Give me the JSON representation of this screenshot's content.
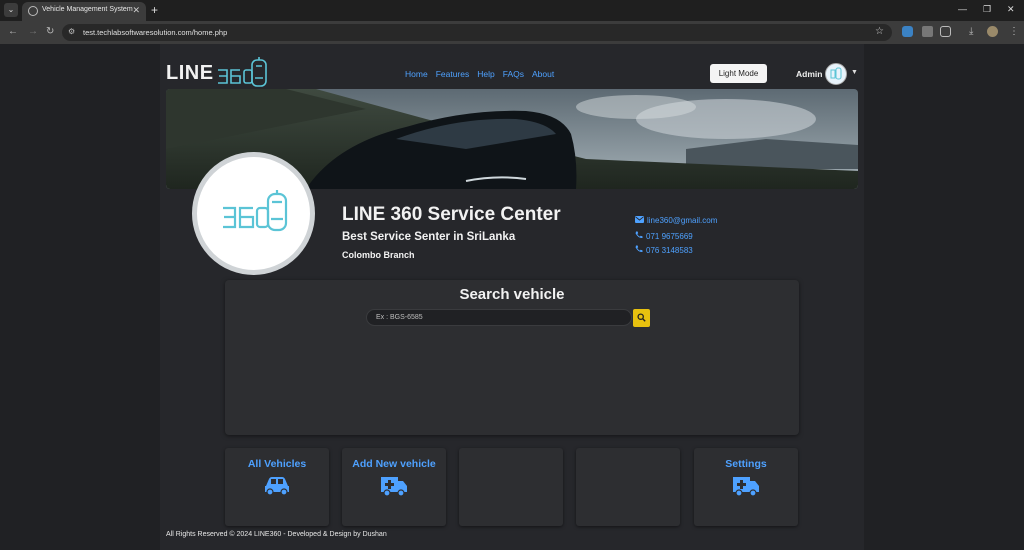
{
  "browser": {
    "tab_title": "Vehicle Management System",
    "url": "test.techlabsoftwaresolution.com/home.php"
  },
  "header": {
    "logo_text": "LINE",
    "nav": [
      "Home",
      "Features",
      "Help",
      "FAQs",
      "About"
    ],
    "light_mode_label": "Light Mode",
    "user_name": "Admin"
  },
  "profile": {
    "name": "LINE 360 Service Center",
    "tagline": "Best Service Senter in SriLanka",
    "branch": "Colombo Branch",
    "email": "line360@gmail.com",
    "phone1": "071 9675669",
    "phone2": "076 3148583"
  },
  "search": {
    "title": "Search vehicle",
    "placeholder": "Ex : BGS-6585"
  },
  "cards": {
    "all_vehicles": "All Vehicles",
    "add_vehicle": "Add New vehicle",
    "settings": "Settings"
  },
  "footer": "All Rights Reserved © 2024 LINE360 - Developed & Design by Dushan",
  "colors": {
    "accent": "#4ea1ff",
    "search_button": "#e7c10f",
    "logo_teal": "#5bc4d6"
  }
}
